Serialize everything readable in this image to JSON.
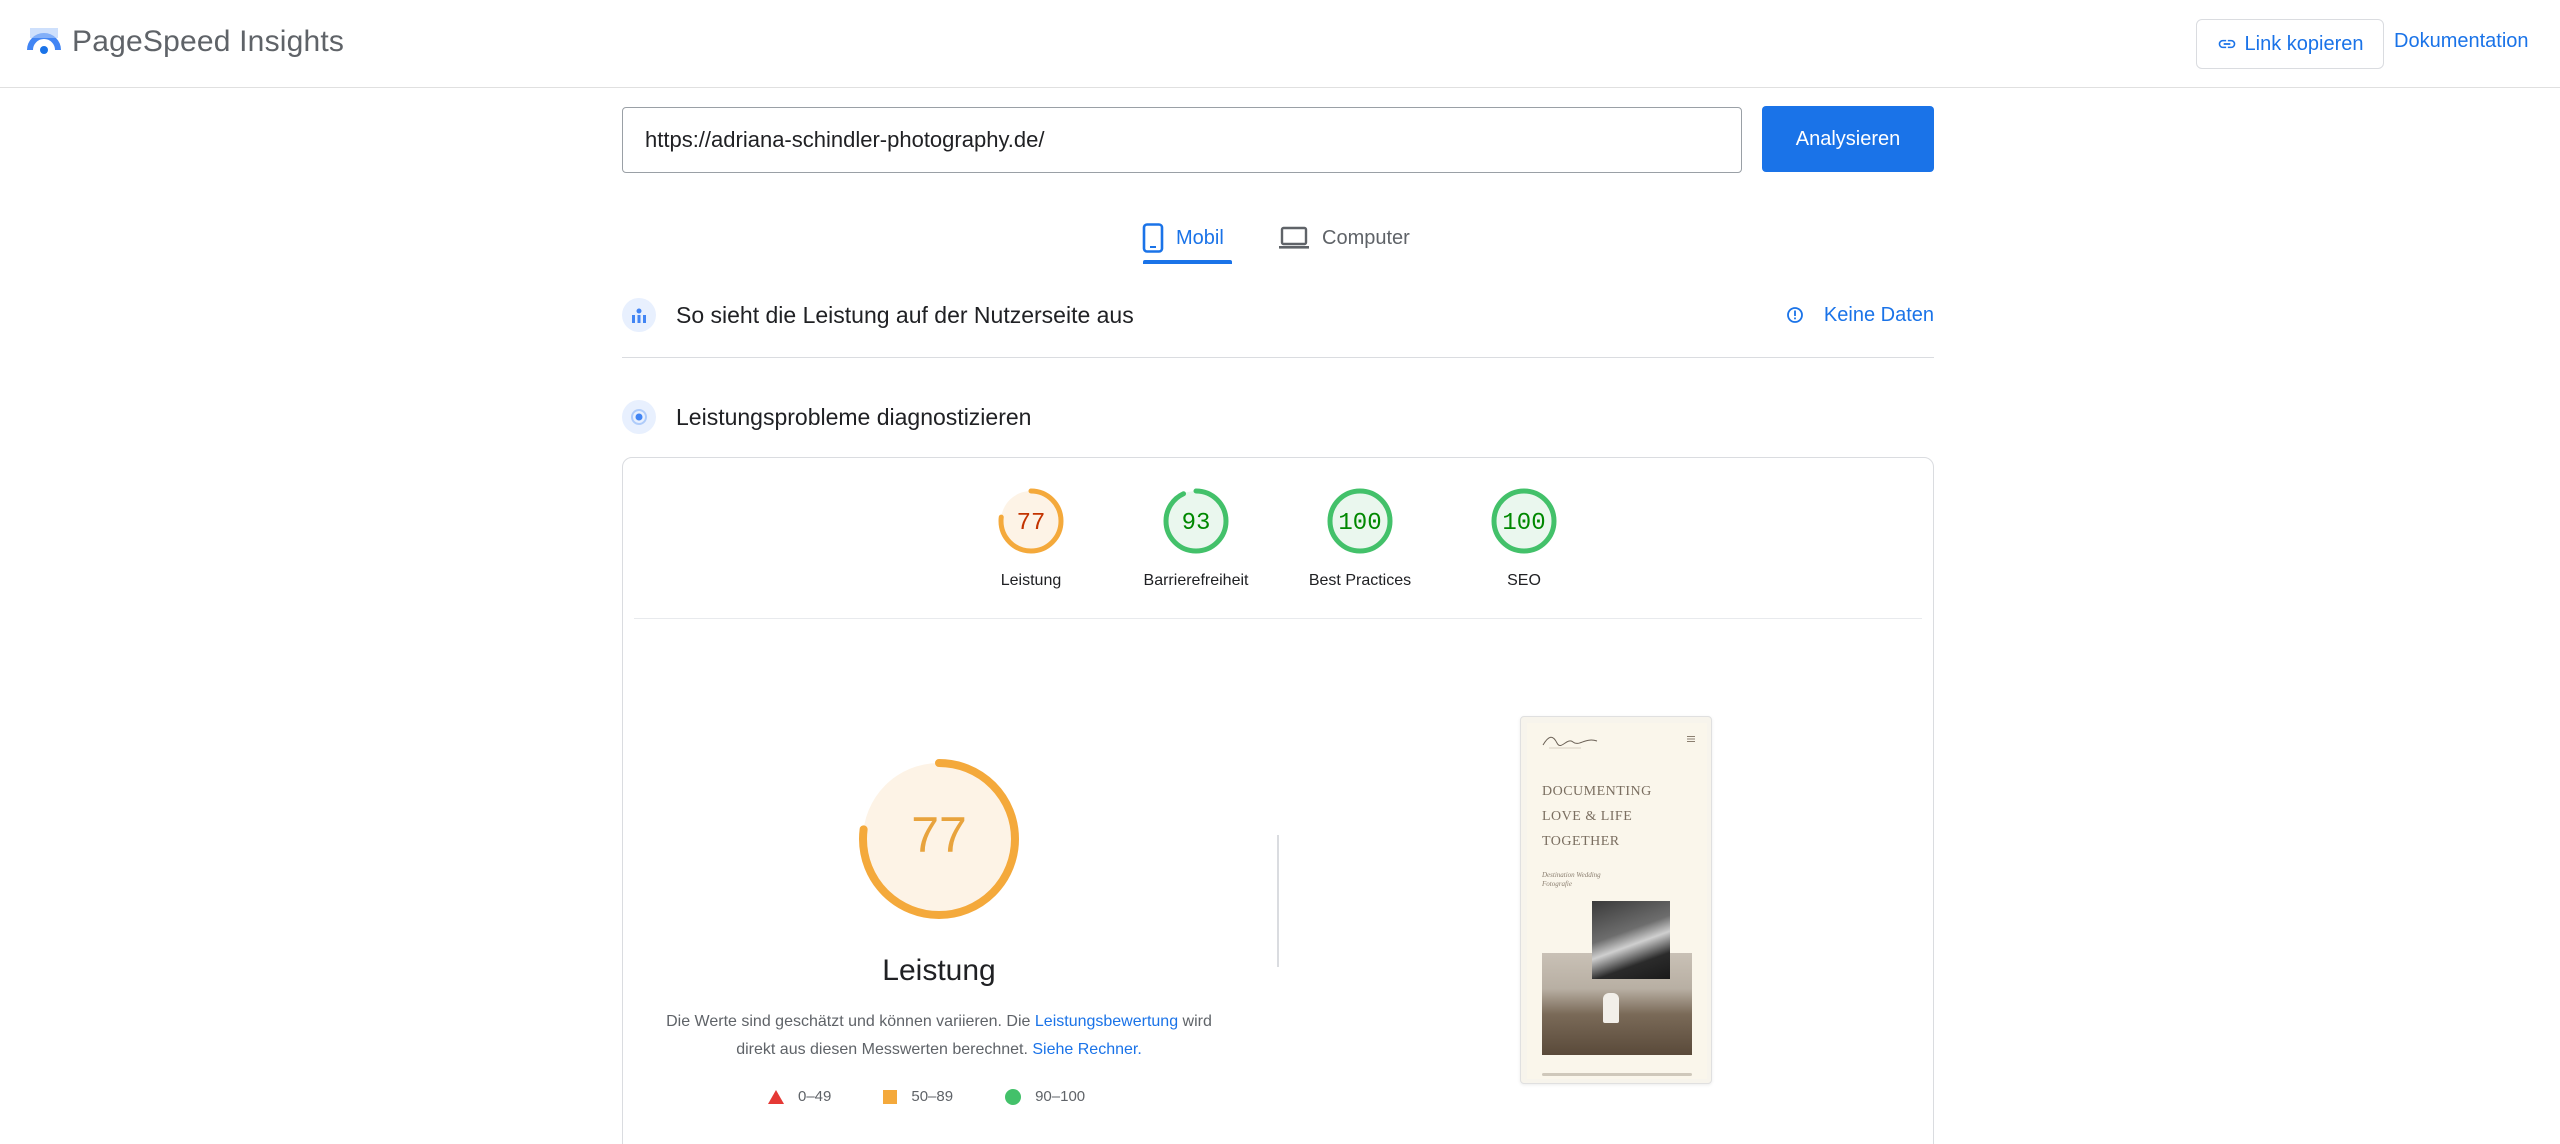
{
  "header": {
    "app_name": "PageSpeed Insights",
    "copy_link_label": "Link kopieren",
    "docs_label": "Dokumentation"
  },
  "search": {
    "url_value": "https://adriana-schindler-photography.de/",
    "analyze_label": "Analysieren"
  },
  "tabs": [
    {
      "label": "Mobil",
      "selected": true,
      "icon": "smartphone-icon"
    },
    {
      "label": "Computer",
      "selected": false,
      "icon": "laptop-icon"
    }
  ],
  "field_data": {
    "title": "So sieht die Leistung auf der Nutzerseite aus",
    "no_data_label": "Keine Daten"
  },
  "diagnostics": {
    "title": "Leistungsprobleme diagnostizieren"
  },
  "scores": [
    {
      "label": "Leistung",
      "value": "77",
      "status": "average"
    },
    {
      "label": "Barrierefreiheit",
      "value": "93",
      "status": "good"
    },
    {
      "label": "Best Practices",
      "value": "100",
      "status": "good"
    },
    {
      "label": "SEO",
      "value": "100",
      "status": "good"
    }
  ],
  "performance": {
    "score": "77",
    "label": "Leistung",
    "desc_part1": "Die Werte sind geschätzt und können variieren. Die ",
    "desc_link1": "Leistungsbewertung",
    "desc_part2": " wird direkt aus diesen Messwerten berechnet. ",
    "desc_link2": "Siehe Rechner."
  },
  "legend": [
    {
      "range": "0–49",
      "shape": "triangle",
      "color": "#e53935"
    },
    {
      "range": "50–89",
      "shape": "square",
      "color": "#f4a93b"
    },
    {
      "range": "90–100",
      "shape": "circle",
      "color": "#43c16a"
    }
  ],
  "screenshot": {
    "headline": "DOCUMENTING LOVE & LIFE TOGETHER",
    "subline": "Destination Wedding Fotografie"
  },
  "colors": {
    "accent": "#1a73e8",
    "average": "#f4a93b",
    "average_text": "#c33300",
    "good": "#43c16a",
    "good_text": "#008800",
    "poor": "#e53935"
  }
}
